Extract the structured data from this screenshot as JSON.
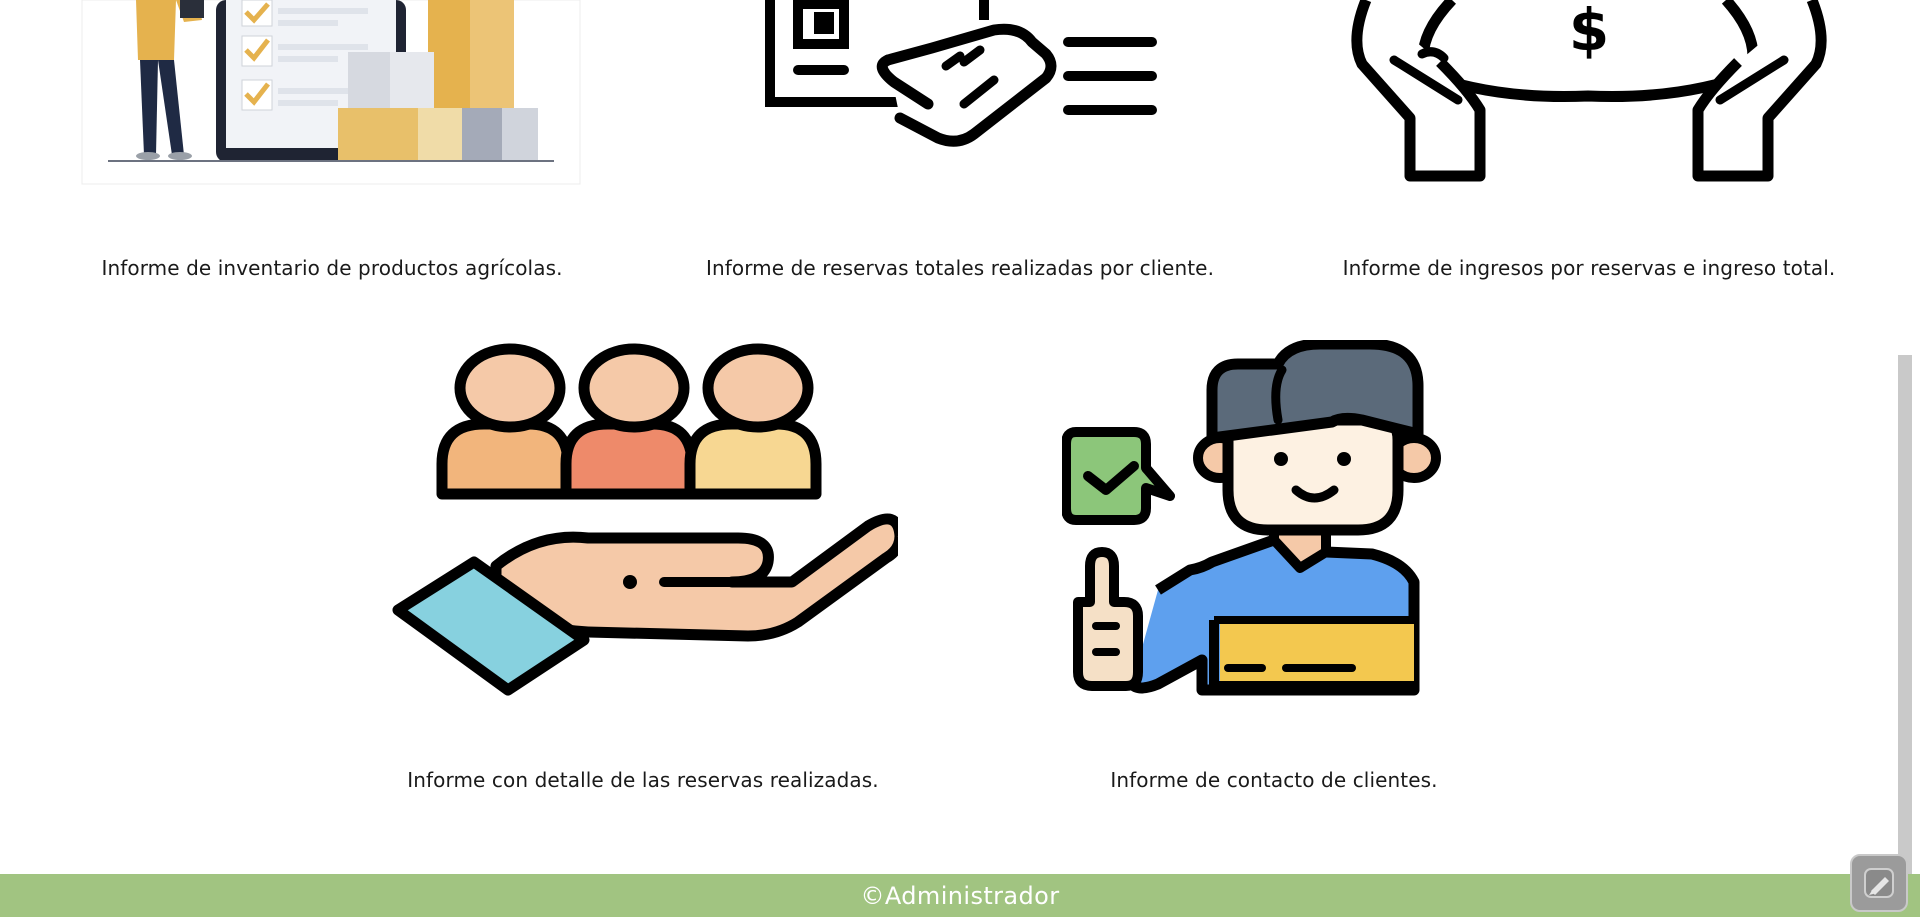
{
  "reports": [
    {
      "caption": "Informe de inventario de productos agrícolas."
    },
    {
      "caption": "Informe de reservas totales realizadas por cliente."
    },
    {
      "caption": "Informe de ingresos por reservas e ingreso total."
    },
    {
      "caption": "Informe con detalle de las reservas realizadas."
    },
    {
      "caption": "Informe de contacto de clientes."
    }
  ],
  "footer": {
    "text": "©Administrador"
  },
  "icons": {
    "inventory": "inventory-checklist-illustration",
    "reservations": "hand-on-card-icon",
    "income": "hands-money-bag-icon",
    "detail": "people-on-hand-icon",
    "contact": "customer-thumbs-up-icon",
    "floating": "edit-icon"
  },
  "colors": {
    "footer_bg": "#a1c481",
    "footer_text": "#ffffff"
  }
}
